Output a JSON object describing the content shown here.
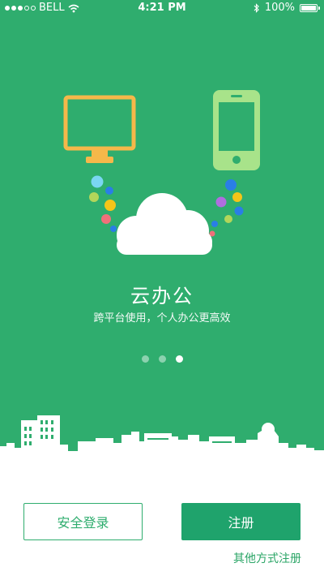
{
  "status_bar": {
    "carrier": "BELL",
    "time": "4:21 PM",
    "battery_percent": "100%",
    "signal_strength": 3,
    "signal_total": 5
  },
  "onboarding": {
    "title": "云办公",
    "subtitle": "跨平台使用，个人办公更高效",
    "page_count": 3,
    "active_page": 3
  },
  "actions": {
    "login_label": "安全登录",
    "register_label": "注册",
    "other_register_label": "其他方式注册"
  },
  "colors": {
    "background": "#2fad6e",
    "accent": "#1fa36c",
    "monitor": "#f5b84a",
    "phone": "#a8e38a"
  },
  "icons": {
    "wifi": "wifi-icon",
    "bluetooth": "bluetooth-icon",
    "battery": "battery-icon",
    "monitor": "monitor-icon",
    "phone": "phone-icon",
    "cloud": "cloud-icon"
  }
}
